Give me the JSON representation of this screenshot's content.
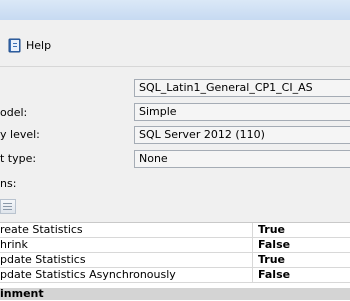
{
  "toolbar": {
    "help_label": "Help"
  },
  "form": {
    "collation": {
      "label": "",
      "value": "SQL_Latin1_General_CP1_CI_AS"
    },
    "recovery_model": {
      "label": "odel:",
      "value": "Simple"
    },
    "compat_level": {
      "label": "y level:",
      "value": "SQL Server 2012 (110)"
    },
    "containment_type": {
      "label": "t type:",
      "value": "None"
    },
    "other_options_label": "ns:"
  },
  "properties": {
    "rows": [
      {
        "name": "reate Statistics",
        "value": "True"
      },
      {
        "name": "hrink",
        "value": "False"
      },
      {
        "name": "pdate Statistics",
        "value": "True"
      },
      {
        "name": "pdate Statistics Asynchronously",
        "value": "False"
      }
    ],
    "category_label": "inment"
  },
  "colors": {
    "combo_border": "#a5acb5",
    "category_bg": "#d4d4d4",
    "grid_bg": "#ffffff"
  }
}
